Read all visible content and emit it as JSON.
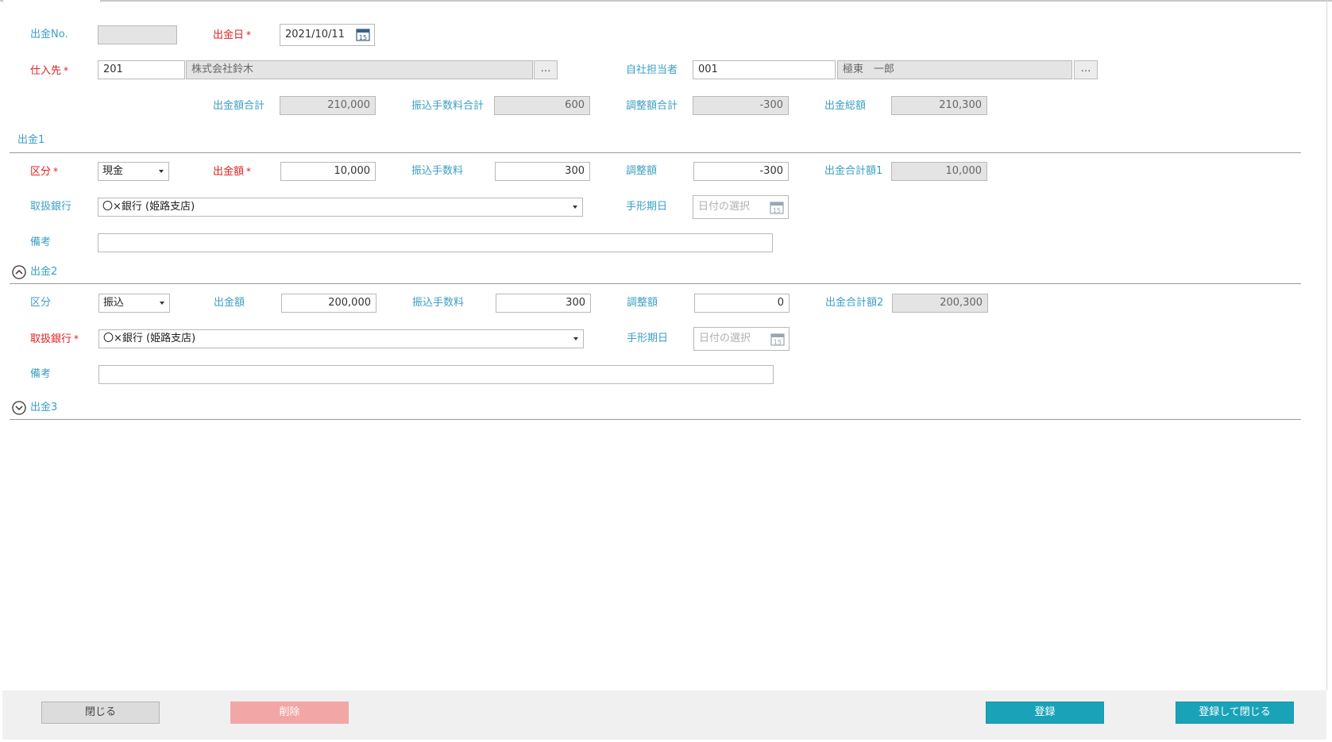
{
  "header": {
    "payment_no_label": "出金No.",
    "payment_no_value": "",
    "payment_date_label": "出金日",
    "payment_date_value": "2021/10/11",
    "supplier_label": "仕入先",
    "supplier_code": "201",
    "supplier_name": "株式会社鈴木",
    "staff_label": "自社担当者",
    "staff_code": "001",
    "staff_name": "極東　一郎",
    "lookup_button": "…",
    "required_mark": "*"
  },
  "totals": {
    "amount_total_label": "出金額合計",
    "amount_total_value": "210,000",
    "fee_total_label": "振込手数料合計",
    "fee_total_value": "600",
    "adjust_total_label": "調整額合計",
    "adjust_total_value": "-300",
    "grand_total_label": "出金総額",
    "grand_total_value": "210,300"
  },
  "payment1": {
    "title": "出金1",
    "category_label": "区分",
    "category_value": "現金",
    "amount_label": "出金額",
    "amount_value": "10,000",
    "fee_label": "振込手数料",
    "fee_value": "300",
    "adjust_label": "調整額",
    "adjust_value": "-300",
    "subtotal_label": "出金合計額1",
    "subtotal_value": "10,000",
    "bank_label": "取扱銀行",
    "bank_value": "〇×銀行 (姫路支店)",
    "due_label": "手形期日",
    "due_placeholder": "日付の選択",
    "memo_label": "備考",
    "memo_value": ""
  },
  "payment2": {
    "title": "出金2",
    "category_label": "区分",
    "category_value": "振込",
    "amount_label": "出金額",
    "amount_value": "200,000",
    "fee_label": "振込手数料",
    "fee_value": "300",
    "adjust_label": "調整額",
    "adjust_value": "0",
    "subtotal_label": "出金合計額2",
    "subtotal_value": "200,300",
    "bank_label": "取扱銀行",
    "bank_value": "〇×銀行 (姫路支店)",
    "due_label": "手形期日",
    "due_placeholder": "日付の選択",
    "memo_label": "備考",
    "memo_value": ""
  },
  "payment3": {
    "title": "出金3"
  },
  "footer": {
    "close_label": "閉じる",
    "delete_label": "削除",
    "register_label": "登録",
    "register_close_label": "登録して閉じる"
  },
  "colors": {
    "label": "#3b9fc4",
    "required": "#e02020",
    "primary_button": "#1aa3b8",
    "delete_button": "#f3a6a6"
  },
  "calendar_icon_day": "15"
}
